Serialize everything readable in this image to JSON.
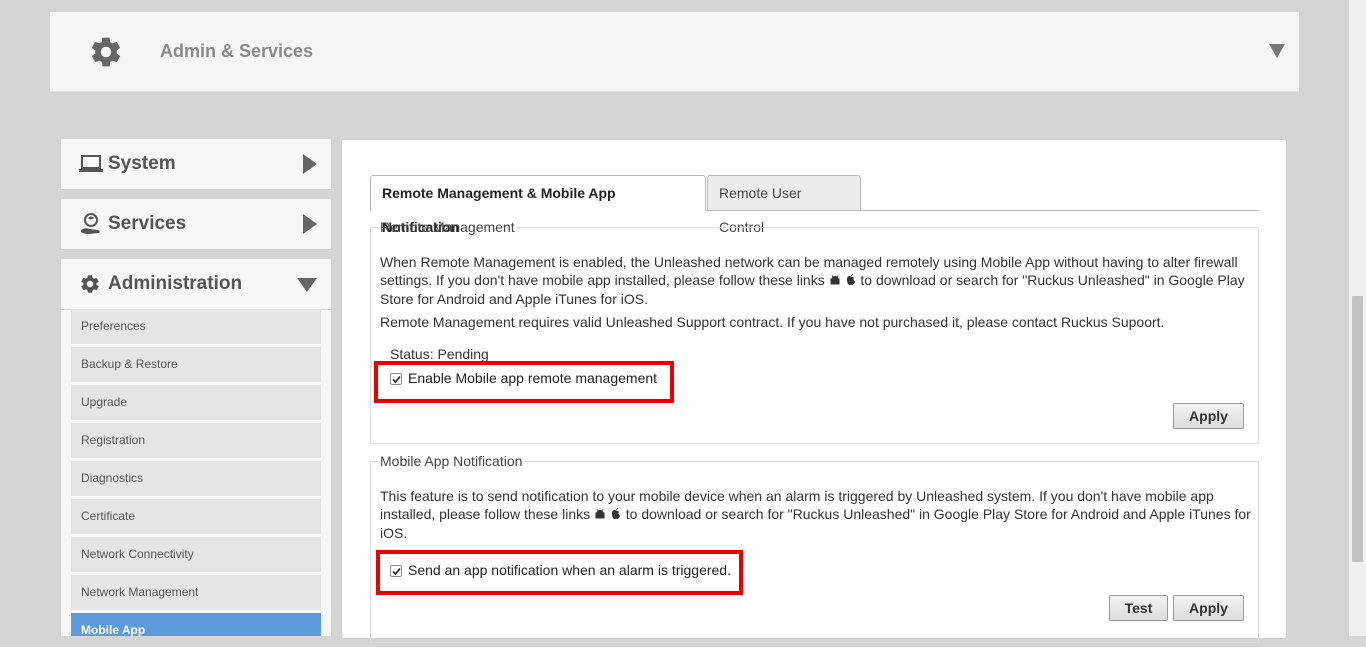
{
  "header": {
    "title": "Admin & Services",
    "icon": "gear-icon",
    "chevron": "chevron-down-icon"
  },
  "nav": {
    "system": {
      "label": "System",
      "icon": "laptop-icon"
    },
    "services": {
      "label": "Services",
      "icon": "services-hand-icon"
    },
    "administration": {
      "label": "Administration",
      "icon": "gear-icon",
      "items": [
        {
          "label": "Preferences"
        },
        {
          "label": "Backup & Restore"
        },
        {
          "label": "Upgrade"
        },
        {
          "label": "Registration"
        },
        {
          "label": "Diagnostics"
        },
        {
          "label": "Certificate"
        },
        {
          "label": "Network Connectivity"
        },
        {
          "label": "Network Management"
        },
        {
          "label": "Mobile App"
        }
      ],
      "active_item": "Mobile App"
    }
  },
  "tabs": [
    {
      "label": "Remote Management & Mobile App Notification",
      "active": true
    },
    {
      "label": "Remote User Control",
      "active": false
    }
  ],
  "remote_management": {
    "legend": "Remote Management",
    "para1_a": "When Remote Management is enabled, the Unleashed network can be managed remotely using Mobile App without having to alter firewall settings. If you don't have mobile app installed, please follow these links",
    "para1_b": "to download or search for \"Ruckus Unleashed\" in Google Play Store for Android and Apple iTunes for iOS.",
    "para2": "Remote Management requires valid Unleashed Support contract. If you have not purchased it, please contact Ruckus Supoort.",
    "status": "Status: Pending",
    "checkbox_label": "Enable Mobile app remote management",
    "checked": true,
    "apply_label": "Apply"
  },
  "mobile_notification": {
    "legend": "Mobile App Notification",
    "para_a": "This feature is to send notification to your mobile device when an alarm is triggered by Unleashed system. If you don't have mobile app installed, please follow these links",
    "para_b": "to download or search for \"Ruckus Unleashed\" in Google Play Store for Android and Apple iTunes for iOS.",
    "checkbox_label": "Send an app notification when an alarm is triggered.",
    "checked": true,
    "test_label": "Test",
    "apply_label": "Apply"
  },
  "colors": {
    "highlight": "#e60000",
    "active_nav": "#5b9bdc"
  }
}
